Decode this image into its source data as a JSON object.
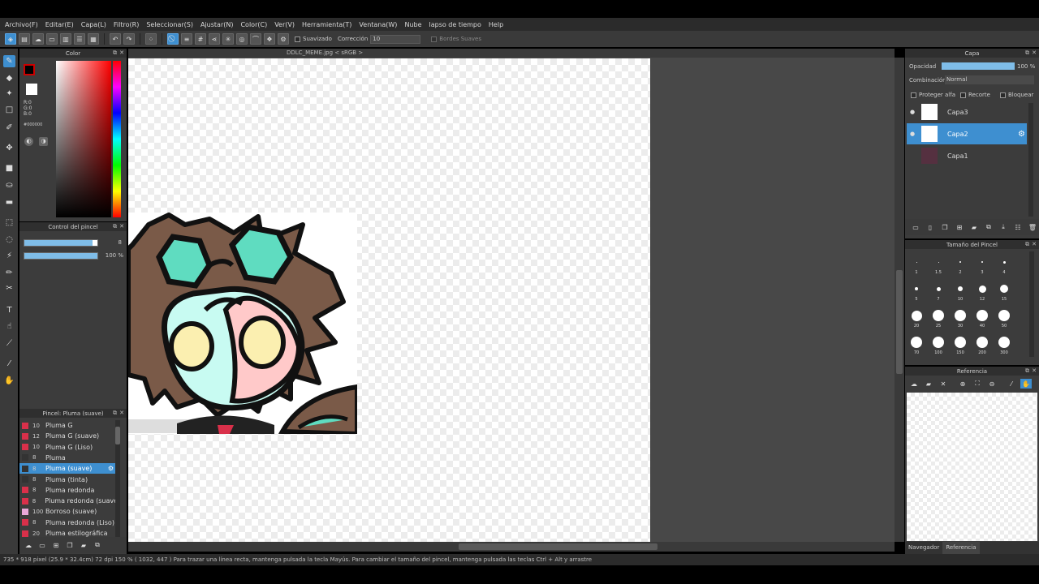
{
  "menu": [
    "Archivo(F)",
    "Editar(E)",
    "Capa(L)",
    "Filtro(R)",
    "Seleccionar(S)",
    "Ajustar(N)",
    "Color(C)",
    "Ver(V)",
    "Herramienta(T)",
    "Ventana(W)",
    "Nube",
    "lapso de tiempo",
    "Help"
  ],
  "toolbar": {
    "smooth_label": "Suavizado",
    "correction_label": "Corrección",
    "correction_value": "10",
    "soft_edges_label": "Bordes Suaves"
  },
  "document": {
    "title": "DDLC_MEME.jpg < sRGB >"
  },
  "color_panel": {
    "title": "Color",
    "r": "R:0",
    "g": "G:0",
    "b": "B:0",
    "hex": "#000000",
    "current_color": "#000000"
  },
  "brush_control": {
    "title": "Control del pincel",
    "size": "8",
    "opacity": "100 %",
    "size_fraction": 0.93,
    "opacity_fraction": 1.0
  },
  "brush_list": {
    "title": "Pincel: Pluma (suave)",
    "items": [
      {
        "size": "10",
        "label": "Pluma G",
        "color": "#d9304a"
      },
      {
        "size": "12",
        "label": "Pluma G (suave)",
        "color": "#d9304a"
      },
      {
        "size": "10",
        "label": "Pluma G (Liso)",
        "color": "#d9304a"
      },
      {
        "size": "8",
        "label": "Pluma",
        "color": "#333333"
      },
      {
        "size": "8",
        "label": "Pluma (suave)",
        "color": "#333333"
      },
      {
        "size": "8",
        "label": "Pluma (tinta)",
        "color": "#333333"
      },
      {
        "size": "8",
        "label": "Pluma redonda",
        "color": "#d9304a"
      },
      {
        "size": "8",
        "label": "Pluma redonda (suave",
        "color": "#d9304a"
      },
      {
        "size": "100",
        "label": "Borroso (suave)",
        "color": "#e8a8d8"
      },
      {
        "size": "8",
        "label": "Pluma redonda (Liso)",
        "color": "#d9304a"
      },
      {
        "size": "20",
        "label": "Pluma estilográfica",
        "color": "#d9304a"
      }
    ]
  },
  "layer_panel": {
    "title": "Capa",
    "opacity_label": "Opacidad",
    "opacity_value": "100 %",
    "opacity_fraction": 1.0,
    "blend_label": "Combinación",
    "blend_value": "Normal",
    "protect_alpha": "Proteger alfa",
    "clip": "Recorte",
    "lock": "Bloquear",
    "layers": [
      "Capa3",
      "Capa2",
      "Capa1"
    ]
  },
  "brush_size_panel": {
    "title": "Tamaño del Pincel",
    "sizes": [
      "1",
      "1.5",
      "2",
      "3",
      "4",
      "5",
      "7",
      "10",
      "12",
      "15",
      "20",
      "25",
      "30",
      "40",
      "50",
      "70",
      "100",
      "150",
      "200",
      "300"
    ]
  },
  "reference_panel": {
    "title": "Referencia",
    "tabs": [
      "Navegador",
      "Referencia"
    ]
  },
  "status": "735 * 918 pixel   (25.9 * 32.4cm)   72 dpi   150 %   ( 1032, 447 )   Para trazar una línea recta, mantenga pulsada la tecla Mayús. Para cambiar el tamaño del pincel, mantenga pulsada las teclas Ctrl + Alt y arrastre",
  "colors": {
    "accent": "#3e8fd0",
    "panel": "#3c3c3c"
  }
}
